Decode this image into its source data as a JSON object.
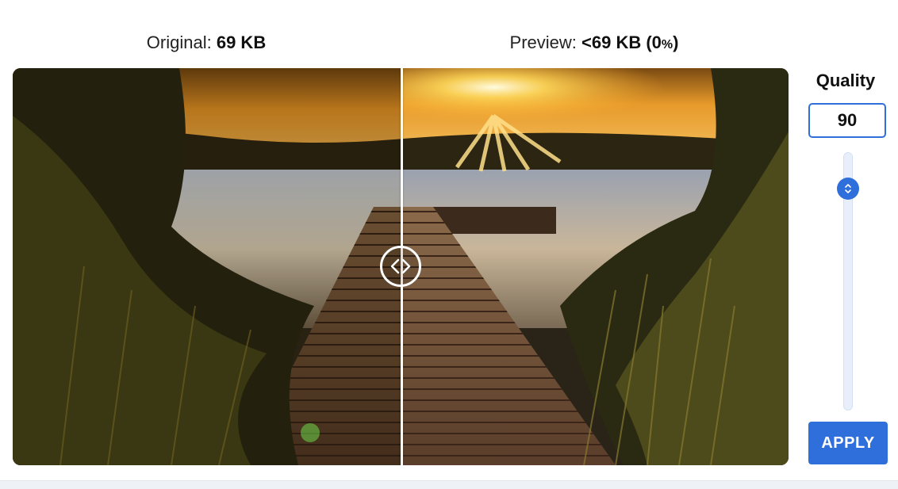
{
  "labels": {
    "original_prefix": "Original: ",
    "original_size": "69 KB",
    "preview_prefix": "Preview: ",
    "preview_size": "<69 KB (0",
    "preview_pct_sign": "%",
    "preview_close": ")"
  },
  "compare": {
    "image_alt": "Wooden pier leading into a lake at sunset",
    "handle_icon": "left-right-chevrons-icon"
  },
  "quality": {
    "title": "Quality",
    "value": "90",
    "slider_icon": "up-down-chevron-icon",
    "apply_label": "APPLY"
  },
  "colors": {
    "accent": "#2f6fdb",
    "page_bg": "#ffffff",
    "footer_band": "#eef1f5"
  }
}
